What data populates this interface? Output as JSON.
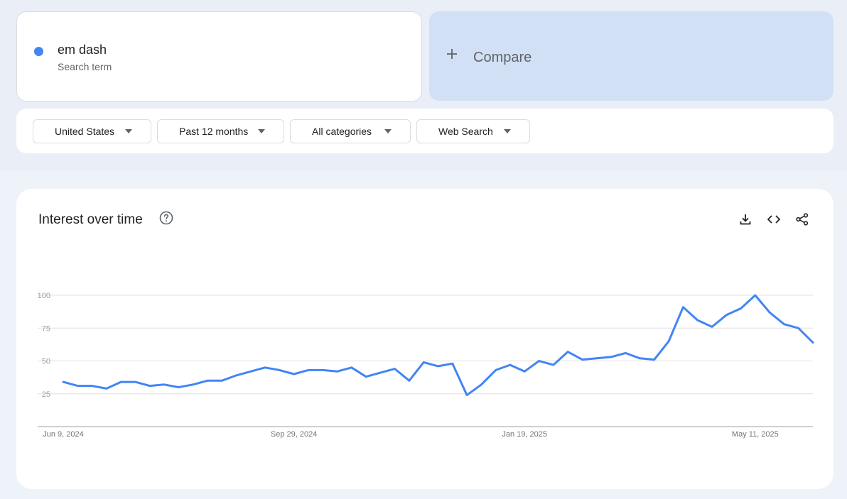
{
  "search_term": {
    "name": "em dash",
    "subtitle": "Search term",
    "color": "#4285f4"
  },
  "compare": {
    "label": "Compare"
  },
  "filters": [
    {
      "label": "United States"
    },
    {
      "label": "Past 12 months"
    },
    {
      "label": "All categories"
    },
    {
      "label": "Web Search"
    }
  ],
  "chart": {
    "title": "Interest over time",
    "actions": [
      "download-icon",
      "embed-code-icon",
      "share-icon"
    ]
  },
  "chart_data": {
    "type": "line",
    "title": "Interest over time",
    "xlabel": "",
    "ylabel": "",
    "ylim": [
      0,
      100
    ],
    "y_ticks": [
      25,
      50,
      75,
      100
    ],
    "grid": true,
    "x_tick_labels": [
      {
        "index": 0,
        "label": "Jun 9, 2024"
      },
      {
        "index": 16,
        "label": "Sep 29, 2024"
      },
      {
        "index": 32,
        "label": "Jan 19, 2025"
      },
      {
        "index": 48,
        "label": "May 11, 2025"
      }
    ],
    "series": [
      {
        "color": "#4285f4",
        "values": [
          34,
          31,
          31,
          29,
          34,
          34,
          31,
          32,
          30,
          32,
          35,
          35,
          39,
          42,
          45,
          43,
          40,
          43,
          43,
          42,
          45,
          38,
          41,
          44,
          35,
          49,
          46,
          48,
          24,
          32,
          43,
          47,
          42,
          50,
          47,
          57,
          51,
          52,
          53,
          56,
          52,
          51,
          65,
          91,
          81,
          76,
          85,
          90,
          100,
          87,
          78,
          75,
          64
        ]
      }
    ]
  }
}
